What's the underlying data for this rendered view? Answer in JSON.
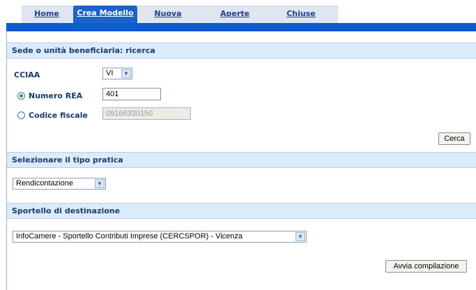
{
  "tabs": [
    {
      "label": "Home"
    },
    {
      "label": "Crea Modello"
    },
    {
      "label": "Nuova"
    },
    {
      "label": "Aperte"
    },
    {
      "label": "Chiuse"
    }
  ],
  "active_tab": "Crea Modello",
  "search_section": {
    "title": "Sede o unità beneficiaria: ricerca",
    "cciaa_label": "CCIAA",
    "cciaa_value": "VI",
    "rea_label": "Numero REA",
    "rea_value": "401",
    "cf_label": "Codice fiscale",
    "cf_value": "09166330150",
    "selected_option": "Numero REA",
    "search_button": "Cerca"
  },
  "practice_section": {
    "title": "Selezionare il tipo pratica",
    "selected": "Rendicontazione"
  },
  "desk_section": {
    "title": "Sportello di destinazione",
    "selected": "InfoCamere - Sportello Contributi Imprese (CERCSPOR) - Vicenza"
  },
  "start_button": "Avvia compilazione",
  "colors": {
    "accent_blue": "#0f5ad2",
    "active_tab": "#1a63c8",
    "section_header_bg": "#dcebfa",
    "label_text": "#1a3a6b",
    "radio_selected": "#2e9a3a"
  },
  "icons": {
    "dropdown": "chevron-down-icon",
    "radio": "radio-icon"
  }
}
